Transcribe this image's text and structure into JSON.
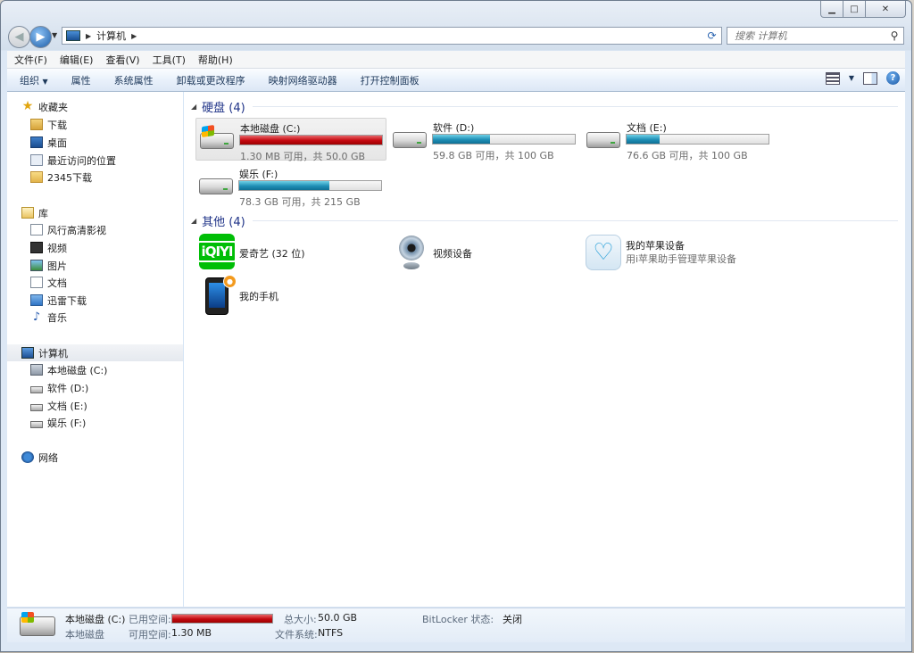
{
  "window": {
    "caption_buttons": [
      "▁",
      "□",
      "✕"
    ]
  },
  "nav": {
    "address_path": [
      "计算机"
    ],
    "search_placeholder": "搜索 计算机"
  },
  "menubar": {
    "items": [
      "文件(F)",
      "编辑(E)",
      "查看(V)",
      "工具(T)",
      "帮助(H)"
    ]
  },
  "commandbar": {
    "organize": "组织",
    "items": [
      "属性",
      "系统属性",
      "卸载或更改程序",
      "映射网络驱动器",
      "打开控制面板"
    ]
  },
  "sidebar": {
    "favorites": {
      "title": "收藏夹",
      "items": [
        "下载",
        "桌面",
        "最近访问的位置",
        "2345下载"
      ]
    },
    "libraries": {
      "title": "库",
      "items": [
        "风行高清影视",
        "视频",
        "图片",
        "文档",
        "迅雷下载",
        "音乐"
      ]
    },
    "computer": {
      "title": "计算机",
      "items": [
        "本地磁盘 (C:)",
        "软件 (D:)",
        "文档 (E:)",
        "娱乐 (F:)"
      ]
    },
    "network": {
      "title": "网络"
    }
  },
  "content": {
    "hard_drives": {
      "header": "硬盘 (4)",
      "drives": [
        {
          "name": "本地磁盘 (C:)",
          "free_text": "1.30 MB 可用，共 50.0 GB",
          "used_fraction": 1.0,
          "bar_color": "#c4080f"
        },
        {
          "name": "软件 (D:)",
          "free_text": "59.8 GB 可用，共 100 GB",
          "used_fraction": 0.402,
          "bar_color": "#1f8fb6"
        },
        {
          "name": "文档 (E:)",
          "free_text": "76.6 GB 可用，共 100 GB",
          "used_fraction": 0.234,
          "bar_color": "#1f8fb6"
        },
        {
          "name": "娱乐 (F:)",
          "free_text": "78.3 GB 可用，共 215 GB",
          "used_fraction": 0.636,
          "bar_color": "#1f8fb6"
        }
      ]
    },
    "other": {
      "header": "其他 (4)",
      "items": [
        {
          "name": "爱奇艺 (32 位)",
          "icon": "iqiyi-icon",
          "icon_text": "iQIYI"
        },
        {
          "name": "视频设备",
          "icon": "webcam-icon"
        },
        {
          "name": "我的苹果设备",
          "sub": "用i苹果助手管理苹果设备",
          "icon": "apple-helper-icon"
        },
        {
          "name": "我的手机",
          "icon": "phone-icon"
        }
      ]
    }
  },
  "details": {
    "drive_name": "本地磁盘 (C:)",
    "drive_type": "本地磁盘",
    "used_label": "已用空间:",
    "used_fraction": 1.0,
    "free_label": "可用空间:",
    "free_value": "1.30 MB",
    "total_label": "总大小:",
    "total_value": "50.0 GB",
    "fs_label": "文件系统:",
    "fs_value": "NTFS",
    "bitlocker_label": "BitLocker 状态:",
    "bitlocker_value": "关闭"
  }
}
